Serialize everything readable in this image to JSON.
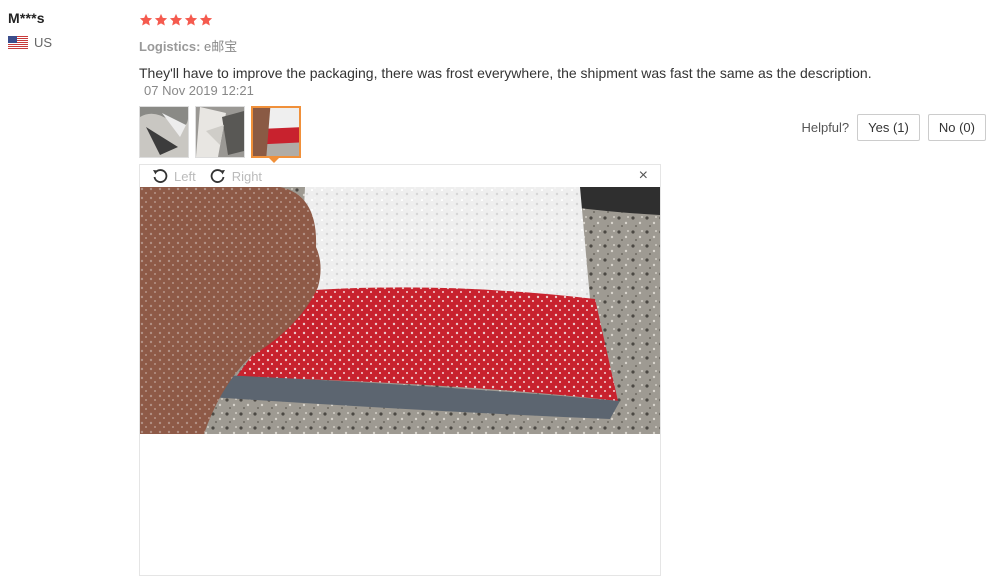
{
  "reviewer": {
    "name": "M***s",
    "country": "US",
    "flag_icon": "us-flag-icon"
  },
  "review": {
    "rating": 5,
    "max_rating": 5,
    "star_color": "#f55a4e",
    "logistics_label": "Logistics:",
    "logistics_value": "e邮宝",
    "text": "They'll have to improve the packaging, there was frost everywhere, the shipment was fast the same as the description.",
    "date": "07 Nov 2019 12:21"
  },
  "helpful": {
    "label": "Helpful?",
    "yes_label": "Yes (1)",
    "no_label": "No (0)"
  },
  "viewer": {
    "rotate_left_label": "Left",
    "rotate_right_label": "Right",
    "close_label": "×",
    "accent": "#f0903a"
  }
}
